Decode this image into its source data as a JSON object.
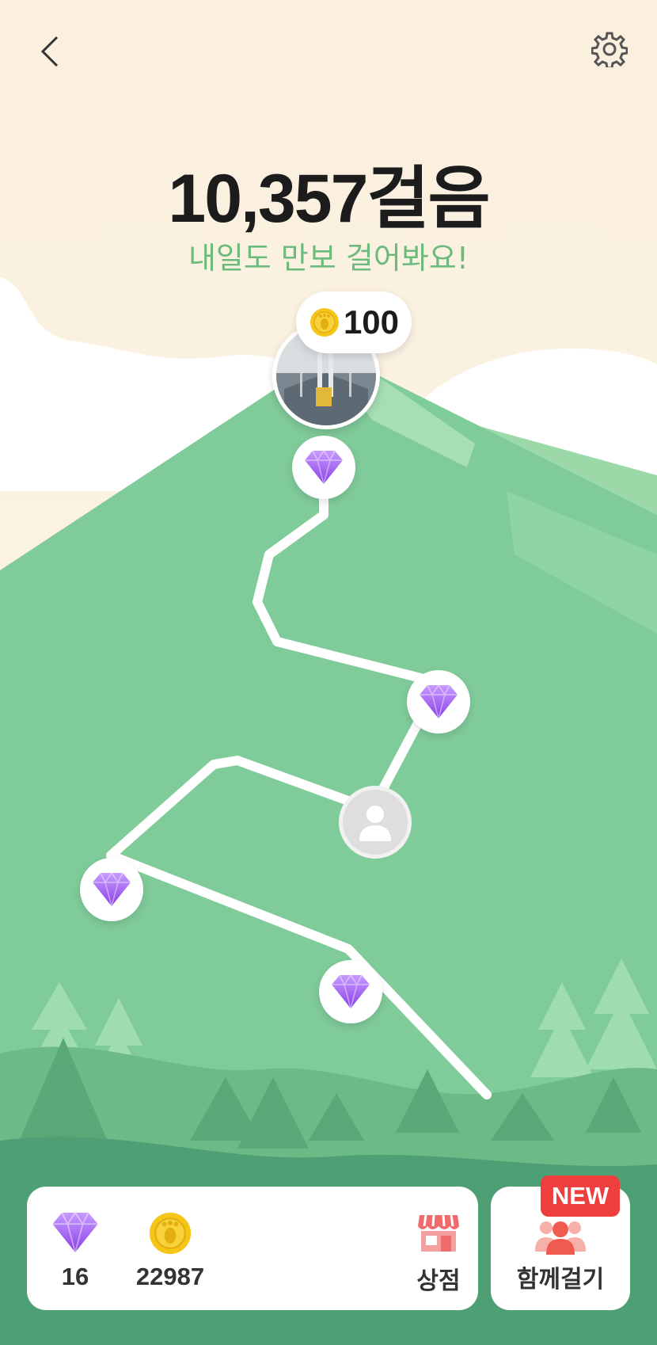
{
  "header": {
    "back_icon": "chevron-left-icon",
    "settings_icon": "gear-icon"
  },
  "summary": {
    "steps": "10,357걸음",
    "message": "내일도 만보 걸어봐요!"
  },
  "peak_reward": {
    "coin_value": "100",
    "coin_icon": "footprint-coin-icon"
  },
  "path_nodes": [
    {
      "type": "diamond",
      "icon": "diamond-icon"
    },
    {
      "type": "diamond",
      "icon": "diamond-icon"
    },
    {
      "type": "current-user",
      "icon": "user-avatar-icon"
    },
    {
      "type": "diamond",
      "icon": "diamond-icon"
    },
    {
      "type": "diamond",
      "icon": "diamond-icon"
    }
  ],
  "wallet": {
    "diamonds": "16",
    "coins": "22987",
    "shop_label": "상점"
  },
  "walk_together": {
    "label": "함께걸기",
    "badge": "NEW"
  },
  "colors": {
    "accent_green": "#6dbb7c",
    "mountain": "#80cb9a",
    "badge_red": "#ee3e3e",
    "diamond": "#9b5cf0"
  }
}
